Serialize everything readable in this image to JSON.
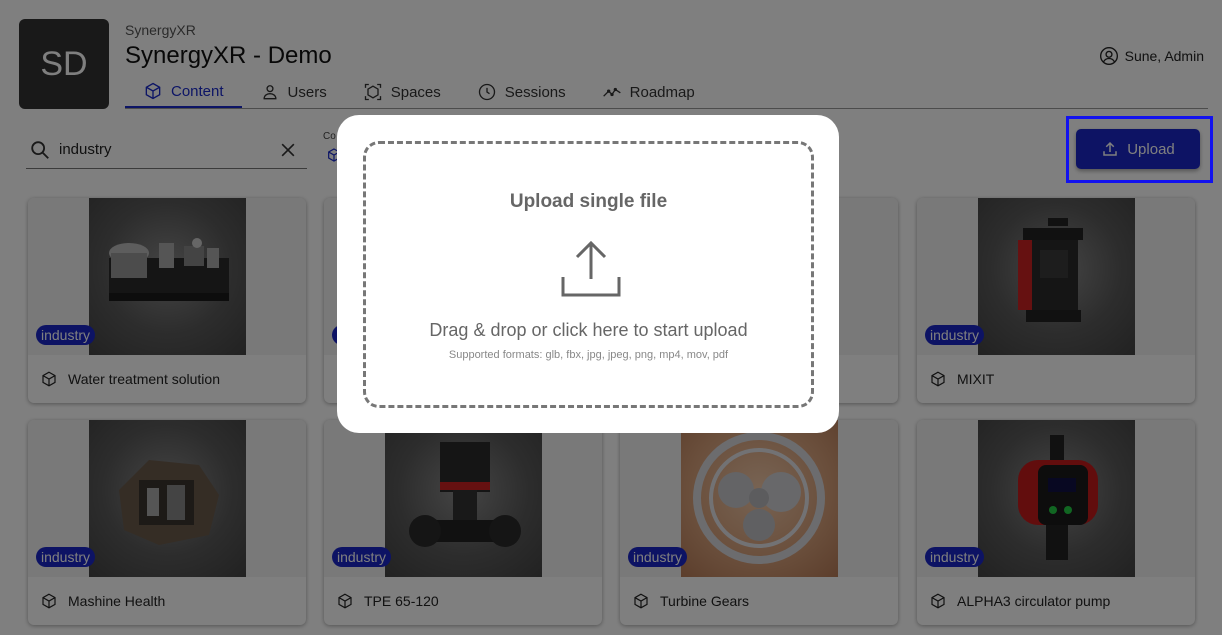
{
  "header": {
    "logo_initials": "SD",
    "org_small": "SynergyXR",
    "org_title": "SynergyXR - Demo",
    "user_name": "Sune, Admin"
  },
  "tabs": [
    {
      "label": "Content",
      "icon": "cube-icon",
      "active": true
    },
    {
      "label": "Users",
      "icon": "user-icon",
      "active": false
    },
    {
      "label": "Spaces",
      "icon": "spaces-icon",
      "active": false
    },
    {
      "label": "Sessions",
      "icon": "clock-icon",
      "active": false
    },
    {
      "label": "Roadmap",
      "icon": "roadmap-icon",
      "active": false
    }
  ],
  "search": {
    "value": "industry"
  },
  "filter": {
    "label_partial": "Co"
  },
  "upload": {
    "label": "Upload"
  },
  "cards": [
    {
      "title": "Water treatment solution",
      "tag": "industry"
    },
    {
      "title": "",
      "tag": "industry"
    },
    {
      "title": "",
      "tag": "industry"
    },
    {
      "title": "MIXIT",
      "tag": "industry"
    },
    {
      "title": "Mashine Health",
      "tag": "industry"
    },
    {
      "title": "TPE 65-120",
      "tag": "industry"
    },
    {
      "title": "Turbine Gears",
      "tag": "industry"
    },
    {
      "title": "ALPHA3 circulator pump",
      "tag": "industry"
    }
  ],
  "modal": {
    "title": "Upload single file",
    "instruction": "Drag & drop or click here to start upload",
    "formats": "Supported formats: glb, fbx, jpg, jpeg, png, mp4, mov, pdf"
  },
  "colors": {
    "accent": "#1a26c8",
    "highlight": "#1212ee",
    "logo_bg": "#333333"
  }
}
